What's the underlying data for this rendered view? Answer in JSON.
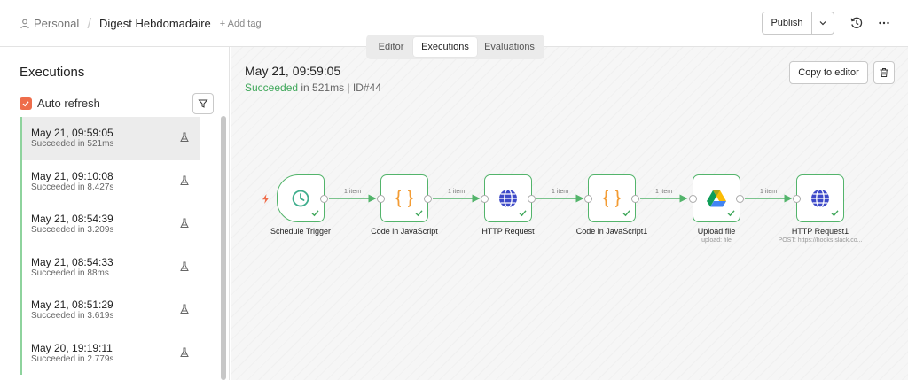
{
  "header": {
    "project": "Personal",
    "separator": "/",
    "workflow_title": "Digest Hebdomadaire",
    "add_tag": "+ Add tag",
    "publish_label": "Publish"
  },
  "tabs": [
    {
      "label": "Editor"
    },
    {
      "label": "Executions"
    },
    {
      "label": "Evaluations"
    }
  ],
  "sidebar": {
    "title": "Executions",
    "auto_refresh_label": "Auto refresh",
    "auto_refresh_checked": true,
    "items": [
      {
        "time": "May 21, 09:59:05",
        "status": "Succeeded in 521ms"
      },
      {
        "time": "May 21, 09:10:08",
        "status": "Succeeded in 8.427s"
      },
      {
        "time": "May 21, 08:54:39",
        "status": "Succeeded in 3.209s"
      },
      {
        "time": "May 21, 08:54:33",
        "status": "Succeeded in 88ms"
      },
      {
        "time": "May 21, 08:51:29",
        "status": "Succeeded in 3.619s"
      },
      {
        "time": "May 20, 19:19:11",
        "status": "Succeeded in 2.779s"
      }
    ]
  },
  "execution": {
    "title": "May 21, 09:59:05",
    "status_word": "Succeeded",
    "status_rest": " in 521ms | ID#44",
    "copy_label": "Copy to editor"
  },
  "workflow": {
    "nodes": [
      {
        "label": "Schedule Trigger",
        "sub": "",
        "icon": "clock-icon"
      },
      {
        "label": "Code in JavaScript",
        "sub": "",
        "icon": "code-braces-icon"
      },
      {
        "label": "HTTP Request",
        "sub": "",
        "icon": "globe-icon"
      },
      {
        "label": "Code in JavaScript1",
        "sub": "",
        "icon": "code-braces-icon"
      },
      {
        "label": "Upload file",
        "sub": "upload: file",
        "icon": "google-drive-icon"
      },
      {
        "label": "HTTP Request1",
        "sub": "POST: https://hooks.slack.co...",
        "icon": "globe-icon"
      }
    ],
    "connection_labels": [
      "1 item",
      "1 item",
      "1 item",
      "1 item",
      "1 item"
    ]
  },
  "colors": {
    "accent": "#ee6d4b",
    "success": "#3fa75a",
    "node_border": "#53b46b",
    "list_bar": "#8ed39d",
    "code_icon": "#f39c34",
    "globe_icon": "#3d49c8"
  }
}
